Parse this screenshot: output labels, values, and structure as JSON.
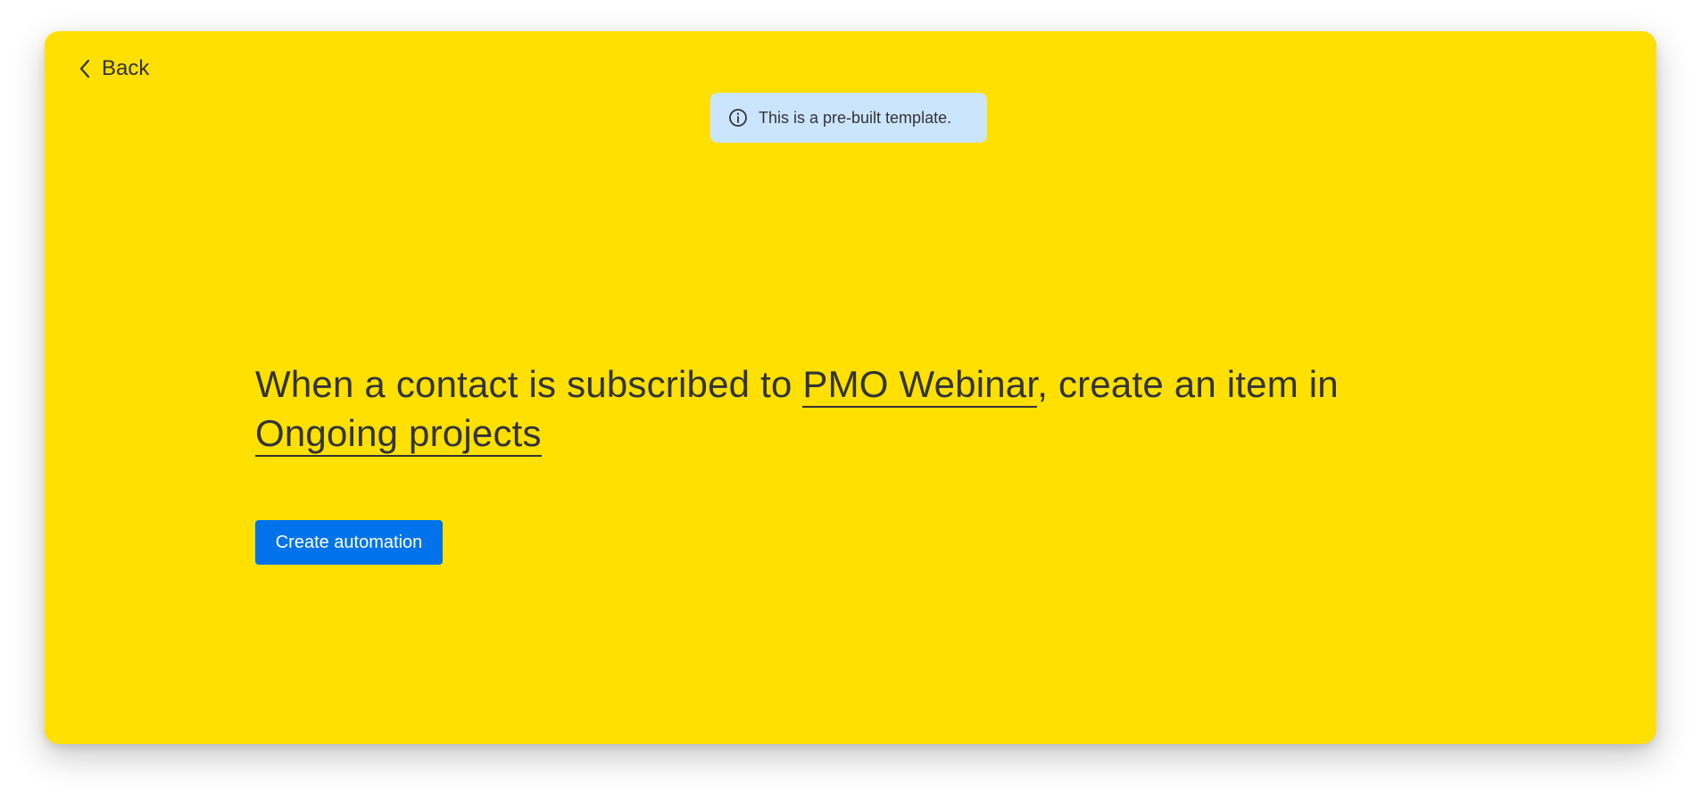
{
  "nav": {
    "back_label": "Back",
    "back_icon": "chevron-left-icon"
  },
  "notice": {
    "icon": "info-icon",
    "text": "This is a pre-built template."
  },
  "recipe": {
    "part1": "When a contact is subscribed to ",
    "trigger_link": "PMO Webinar",
    "part2": ", create an item in ",
    "target_link": "Ongoing projects"
  },
  "actions": {
    "create_label": "Create automation"
  },
  "colors": {
    "card_background": "#ffe000",
    "notice_background": "#cce5ff",
    "primary_button": "#0073ea",
    "text": "#323338"
  }
}
